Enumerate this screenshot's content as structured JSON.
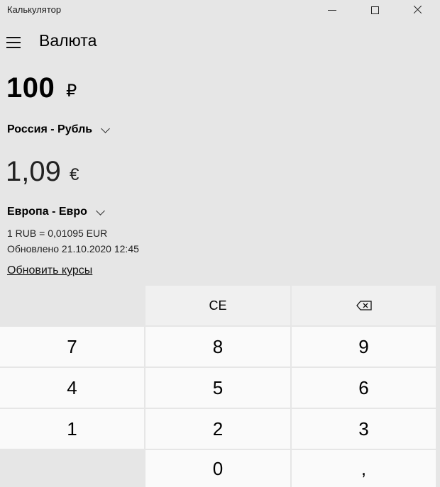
{
  "window": {
    "title": "Калькулятор"
  },
  "header": {
    "mode_title": "Валюта"
  },
  "from": {
    "value": "100",
    "symbol": "₽",
    "currency": "Россия - Рубль"
  },
  "to": {
    "value": "1,09",
    "symbol": "€",
    "currency": "Европа - Евро"
  },
  "info": {
    "rate": "1 RUB = 0,01095 EUR",
    "updated": "Обновлено 21.10.2020 12:45",
    "update_link": "Обновить курсы"
  },
  "keypad": {
    "ce": "CE",
    "k7": "7",
    "k8": "8",
    "k9": "9",
    "k4": "4",
    "k5": "5",
    "k6": "6",
    "k1": "1",
    "k2": "2",
    "k3": "3",
    "k0": "0",
    "decimal": ","
  },
  "icons": {
    "menu": "hamburger-icon",
    "backspace": "backspace-icon",
    "minimize": "minimize-icon",
    "maximize": "maximize-icon",
    "close": "close-icon"
  }
}
